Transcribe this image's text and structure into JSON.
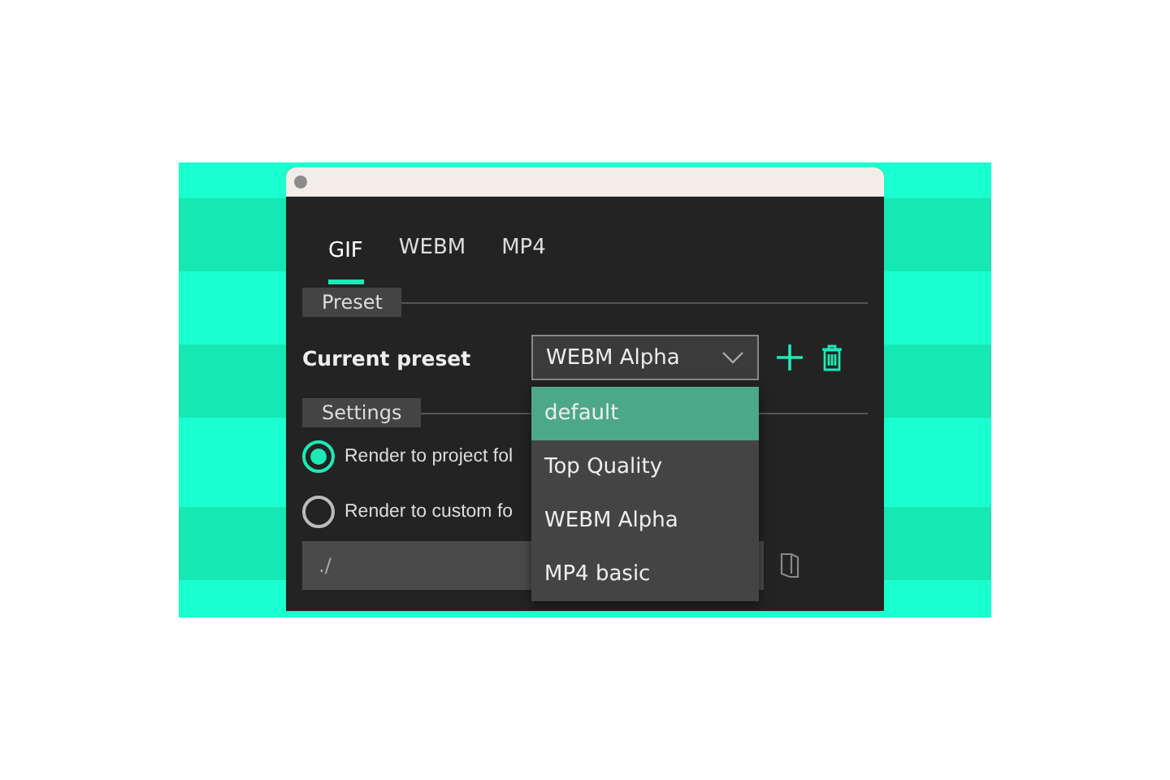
{
  "tabs": [
    {
      "label": "GIF",
      "selected": true
    },
    {
      "label": "WEBM",
      "selected": false
    },
    {
      "label": "MP4",
      "selected": false
    }
  ],
  "preset_section": {
    "title": "Preset",
    "label": "Current preset",
    "value": "WEBM Alpha"
  },
  "settings_section": {
    "title": "Settings",
    "options": [
      {
        "label": "Render to project fol",
        "selected": true
      },
      {
        "label": "Render to custom fo",
        "selected": false
      }
    ],
    "path": "./"
  },
  "dropdown": {
    "items": [
      {
        "label": "default",
        "selected": true
      },
      {
        "label": "Top Quality",
        "selected": false
      },
      {
        "label": "WEBM Alpha",
        "selected": false
      },
      {
        "label": "MP4 basic",
        "selected": false
      }
    ]
  }
}
